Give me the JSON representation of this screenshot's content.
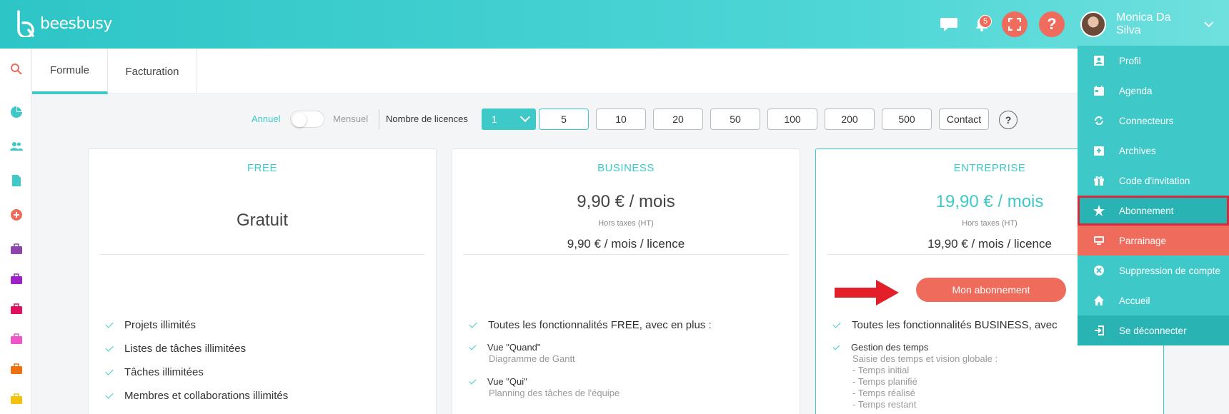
{
  "brand": {
    "name": "beesbusy"
  },
  "header": {
    "notifications_count": "5",
    "help_label": "?",
    "user_name": "Monica Da Silva"
  },
  "tabs": [
    {
      "label": "Formule"
    },
    {
      "label": "Facturation"
    }
  ],
  "controls": {
    "annuel": "Annuel",
    "mensuel": "Mensuel",
    "licences_label": "Nombre de licences",
    "selected_licences": "1",
    "options": [
      "5",
      "10",
      "20",
      "50",
      "100",
      "200",
      "500",
      "Contact"
    ],
    "help": "?"
  },
  "plans": [
    {
      "name": "FREE",
      "price": "Gratuit",
      "features": [
        "Projets illimités",
        "Listes de tâches illimitées",
        "Tâches illimitées",
        "Membres et collaborations illimités"
      ]
    },
    {
      "name": "BUSINESS",
      "price": "9,90 € / mois",
      "tax": "Hors taxes (HT)",
      "per_licence": "9,90 € / mois / licence",
      "headline": "Toutes les fonctionnalités FREE, avec en plus :",
      "features": [
        {
          "title": "Vue \"Quand\"",
          "desc": "Diagramme de Gantt"
        },
        {
          "title": "Vue \"Qui\"",
          "desc": "Planning des tâches de l'équipe"
        }
      ]
    },
    {
      "name": "ENTREPRISE",
      "price": "19,90 € / mois",
      "tax": "Hors taxes (HT)",
      "per_licence": "19,90 € / mois / licence",
      "button": "Mon abonnement",
      "headline": "Toutes les fonctionnalités BUSINESS, avec",
      "feature_title": "Gestion des temps",
      "feature_desc": [
        "Saisie des temps et vision globale :",
        "- Temps initial",
        "- Temps planifié",
        "- Temps réalisé",
        "- Temps restant"
      ]
    }
  ],
  "menu": {
    "items": [
      {
        "label": "Profil",
        "icon": "profile-icon"
      },
      {
        "label": "Agenda",
        "icon": "calendar-icon"
      },
      {
        "label": "Connecteurs",
        "icon": "sync-icon"
      },
      {
        "label": "Archives",
        "icon": "archive-icon"
      },
      {
        "label": "Code d'invitation",
        "icon": "gift-icon"
      },
      {
        "label": "Abonnement",
        "icon": "star-icon"
      },
      {
        "label": "Parrainage",
        "icon": "monitor-icon"
      },
      {
        "label": "Suppression de compte",
        "icon": "cancel-icon"
      },
      {
        "label": "Accueil",
        "icon": "home-icon"
      },
      {
        "label": "Se déconnecter",
        "icon": "logout-icon"
      }
    ]
  },
  "colors": {
    "teal": "#3ec9c8",
    "red": "#ef6b5c",
    "highlight": "#d62b3b"
  }
}
